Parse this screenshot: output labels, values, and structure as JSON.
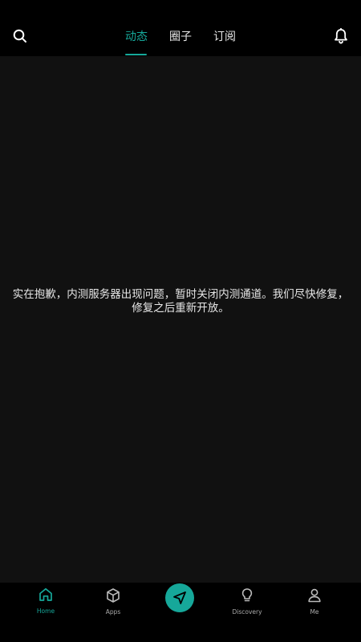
{
  "header": {
    "tabs": [
      {
        "label": "动态",
        "active": true
      },
      {
        "label": "圈子",
        "active": false
      },
      {
        "label": "订阅",
        "active": false
      }
    ],
    "search_icon": "search-icon",
    "notifications_icon": "bell-icon"
  },
  "main": {
    "message_line1": "实在抱歉，内测服务器出现问题，暂时关闭内测通道。我们尽快修复，",
    "message_line2": "修复之后重新开放。"
  },
  "bottom_nav": {
    "items": [
      {
        "label": "Home",
        "icon": "home-icon",
        "active": true
      },
      {
        "label": "Apps",
        "icon": "cube-icon",
        "active": false
      },
      {
        "label": "",
        "icon": "navigation-arrow-icon",
        "active": false
      },
      {
        "label": "Discovery",
        "icon": "lightbulb-icon",
        "active": false
      },
      {
        "label": "Me",
        "icon": "user-icon",
        "active": false
      }
    ]
  },
  "colors": {
    "accent": "#16a89a",
    "background": "#111111",
    "bar": "#000000"
  }
}
